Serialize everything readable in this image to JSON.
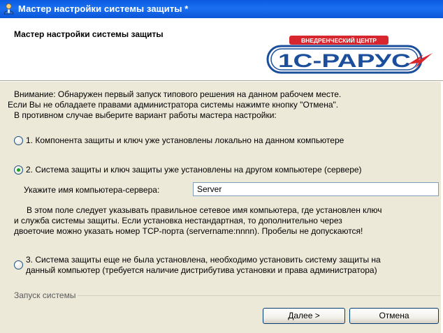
{
  "window": {
    "title": "Мастер настройки системы защиты *"
  },
  "header": {
    "title": "Мастер настройки системы защиты",
    "logo": {
      "badge_text": "ВНЕДРЕНЧЕСКИЙ ЦЕНТР",
      "wordmark": "1С-РАРУС"
    }
  },
  "intro": [
    "Внимание: Обнаружен первый запуск типового решения на данном рабочем месте.",
    "Если Вы не обладаете правами администратора системы нажимте кнопку \"Отмена\".",
    "В противном случае выберите вариант работы мастера настройки:"
  ],
  "options": [
    {
      "label": "1. Компонента защиты и ключ уже установлены локально на данном компьютере",
      "selected": false
    },
    {
      "label": "2. Система защиты и ключ защиты уже установлены на другом компьютере (сервере)",
      "selected": true
    },
    {
      "label_lines": [
        "3. Система защиты еще не была установлена, необходимо установить систему защиты на",
        "данный компьютер (требуется наличие дистрибутива установки и права администратора)"
      ],
      "selected": false
    }
  ],
  "server": {
    "label": "Укажите имя компьютера-сервера:",
    "value": "Server",
    "help": [
      "В этом поле следует указывать правильное сетевое имя компьютера, где установлен ключ",
      "и служба системы защиты. Если установка нестандартная, то дополнительно через",
      "двоеточие можно указать номер TCP-порта (servername:nnnn). Пробелы не допускаются!"
    ]
  },
  "footer": {
    "group_label": "Запуск системы",
    "next_label": "Далее >",
    "cancel_label": "Отмена"
  },
  "colors": {
    "titlebar": "#0a5ae0",
    "dialog_bg": "#ece9d8",
    "logo_blue": "#1b4f9c",
    "logo_red": "#d7262d"
  }
}
